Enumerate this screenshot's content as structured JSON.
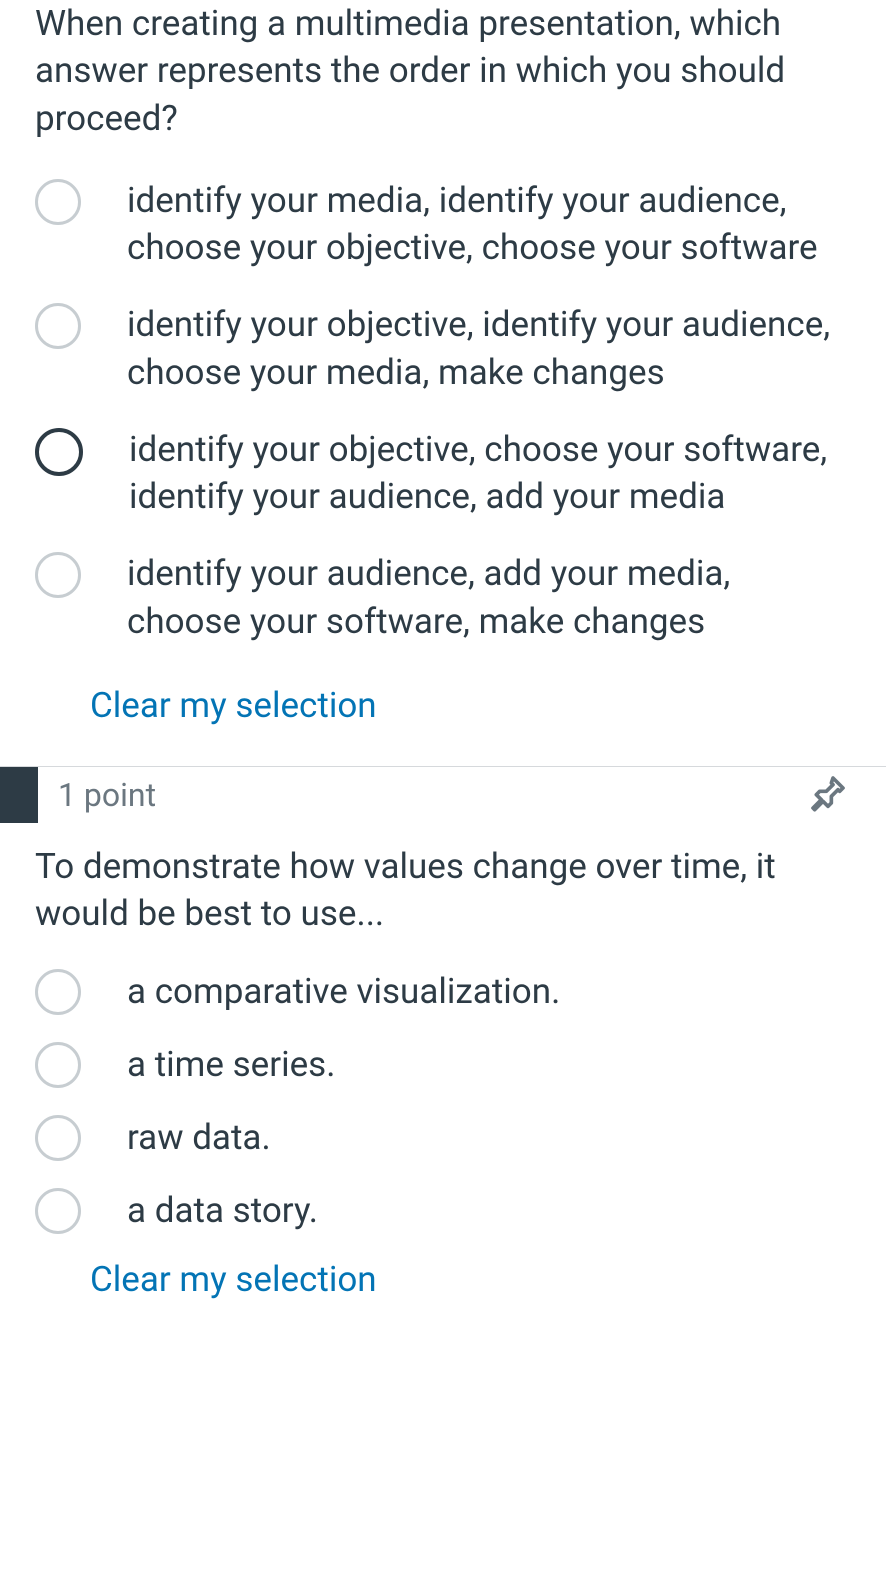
{
  "q1": {
    "text": "When creating a multimedia presentation, which answer represents the order in which you should proceed?",
    "options": [
      "identify your media, identify your audience, choose your objective, choose your software",
      "identify your objective, identify your audience, choose your media, make changes",
      "identify your objective, choose your software, identify your audience, add your media",
      "identify your audience, add your media, choose your software, make changes"
    ],
    "clear": "Clear my selection"
  },
  "q2": {
    "points": "1 point",
    "text": "To demonstrate how values change over time, it would be best to use...",
    "options": [
      "a comparative visualization.",
      "a time series.",
      "raw data.",
      "a data story."
    ],
    "clear": "Clear my selection"
  }
}
